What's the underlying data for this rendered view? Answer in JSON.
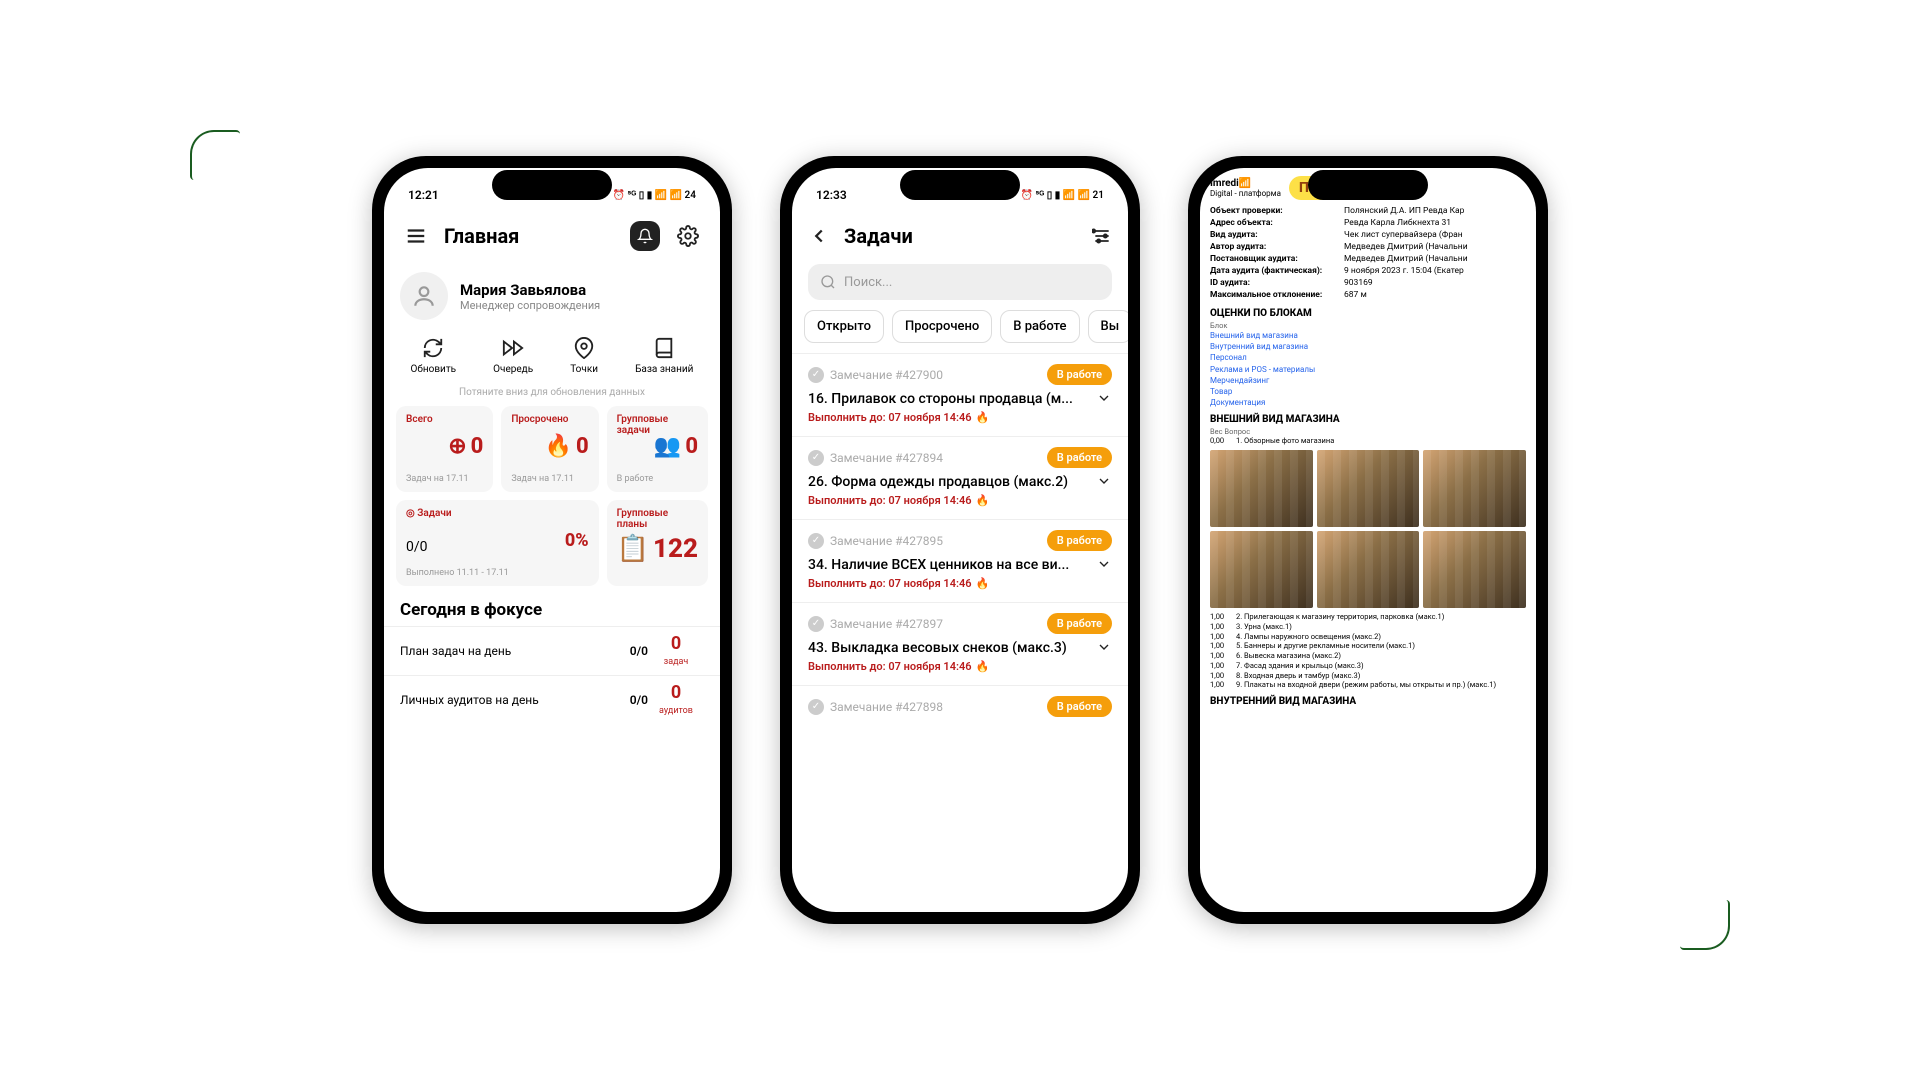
{
  "phone1": {
    "status": {
      "time": "12:21",
      "icons": "⏰ ⁵ᴳ ▯ ▮ 📶 📶 24"
    },
    "header": {
      "title": "Главная"
    },
    "user": {
      "name": "Мария Завьялова",
      "role": "Менеджер сопровождения"
    },
    "quick": [
      {
        "label": "Обновить"
      },
      {
        "label": "Очередь"
      },
      {
        "label": "Точки"
      },
      {
        "label": "База знаний"
      }
    ],
    "hint": "Потяните вниз для обновления данных",
    "cards": {
      "total": {
        "label": "Всего",
        "value": "0",
        "sub": "Задач на 17.11"
      },
      "overdue": {
        "label": "Просрочено",
        "value": "0",
        "sub": "Задач на 17.11"
      },
      "group_tasks": {
        "label": "Групповые задачи",
        "value": "0",
        "sub": "В работе"
      },
      "tasks": {
        "label": "Задачи",
        "ratio": "0/0",
        "pct": "0%",
        "sub": "Выполнено 11.11 - 17.11"
      },
      "group_plans": {
        "label": "Групповые планы",
        "value": "122"
      }
    },
    "focus": {
      "title": "Сегодня в фокусе",
      "rows": [
        {
          "label": "План задач на день",
          "ratio": "0/0",
          "count": "0",
          "unit": "задач"
        },
        {
          "label": "Личных аудитов на день",
          "ratio": "0/0",
          "count": "0",
          "unit": "аудитов"
        }
      ]
    }
  },
  "phone2": {
    "status": {
      "time": "12:33",
      "icons": "⏰ ⁵ᴳ ▯ ▮ 📶 📶 21"
    },
    "header": {
      "title": "Задачи"
    },
    "search_placeholder": "Поиск...",
    "chips": [
      "Открыто",
      "Просрочено",
      "В работе",
      "Вы"
    ],
    "tasks": [
      {
        "id": "Замечание #427900",
        "status": "В работе",
        "title": "16. Прилавок со стороны продавца (м...",
        "due": "Выполнить до: 07 ноября 14:46"
      },
      {
        "id": "Замечание #427894",
        "status": "В работе",
        "title": "26. Форма одежды продавцов (макс.2)",
        "due": "Выполнить до: 07 ноября 14:46"
      },
      {
        "id": "Замечание #427895",
        "status": "В работе",
        "title": "34. Наличие ВСЕХ ценников на все ви...",
        "due": "Выполнить до: 07 ноября 14:46"
      },
      {
        "id": "Замечание #427897",
        "status": "В работе",
        "title": "43. Выкладка весовых снеков (макс.3)",
        "due": "Выполнить до: 07 ноября 14:46"
      },
      {
        "id": "Замечание #427898",
        "status": "В работе",
        "title": "",
        "due": ""
      }
    ]
  },
  "phone3": {
    "brand": {
      "name": "Imredi",
      "sub": "Digital - платформа",
      "logo": "ПИВ&Ко"
    },
    "info": [
      [
        "Объект проверки:",
        "Полянский Д.А. ИП Ревда Кар"
      ],
      [
        "Адрес объекта:",
        "Ревда Карла Либкнехта 31"
      ],
      [
        "Вид аудита:",
        "Чек лист супервайзера (Фран"
      ],
      [
        "Автор аудита:",
        "Медведев Дмитрий (Начальни"
      ],
      [
        "Постановщик аудита:",
        "Медведев Дмитрий (Начальни"
      ],
      [
        "Дата аудита (фактическая):",
        "9 ноября 2023 г. 15:04 (Екатер"
      ],
      [
        "ID аудита:",
        "903169"
      ],
      [
        "Максимальное отклонение:",
        "687 м"
      ]
    ],
    "blocks_title": "ОЦЕНКИ ПО БЛОКАМ",
    "blocks_sub": "Блок",
    "blocks": [
      "Внешний вид магазина",
      "Внутренний вид магазина",
      "Персонал",
      "Реклама и POS - материалы",
      "Мерчендайзинг",
      "Товар",
      "Документация"
    ],
    "sect1": "ВНЕШНИЙ ВИД МАГАЗИНА",
    "sect1_cols": "Вес   Вопрос",
    "sect1_first": {
      "w": "0,00",
      "t": "1. Обзорные фото магазина"
    },
    "sect1_rows": [
      {
        "w": "1,00",
        "t": "2. Прилегающая к магазину территория, парковка (макс.1)"
      },
      {
        "w": "1,00",
        "t": "3. Урна (макс.1)"
      },
      {
        "w": "1,00",
        "t": "4. Лампы наружного освещения (макс.2)"
      },
      {
        "w": "1,00",
        "t": "5. Баннеры и другие рекламные носители (макс.1)"
      },
      {
        "w": "1,00",
        "t": "6. Вывеска магазина (макс.2)"
      },
      {
        "w": "1,00",
        "t": "7. Фасад здания и крыльцо (макс.3)"
      },
      {
        "w": "1,00",
        "t": "8. Входная дверь и тамбур (макс.3)"
      },
      {
        "w": "1,00",
        "t": "9. Плакаты на входной двери (режим работы, мы открыты и пр.) (макс.1)"
      }
    ],
    "sect2": "ВНУТРЕННИЙ ВИД МАГАЗИНА"
  }
}
